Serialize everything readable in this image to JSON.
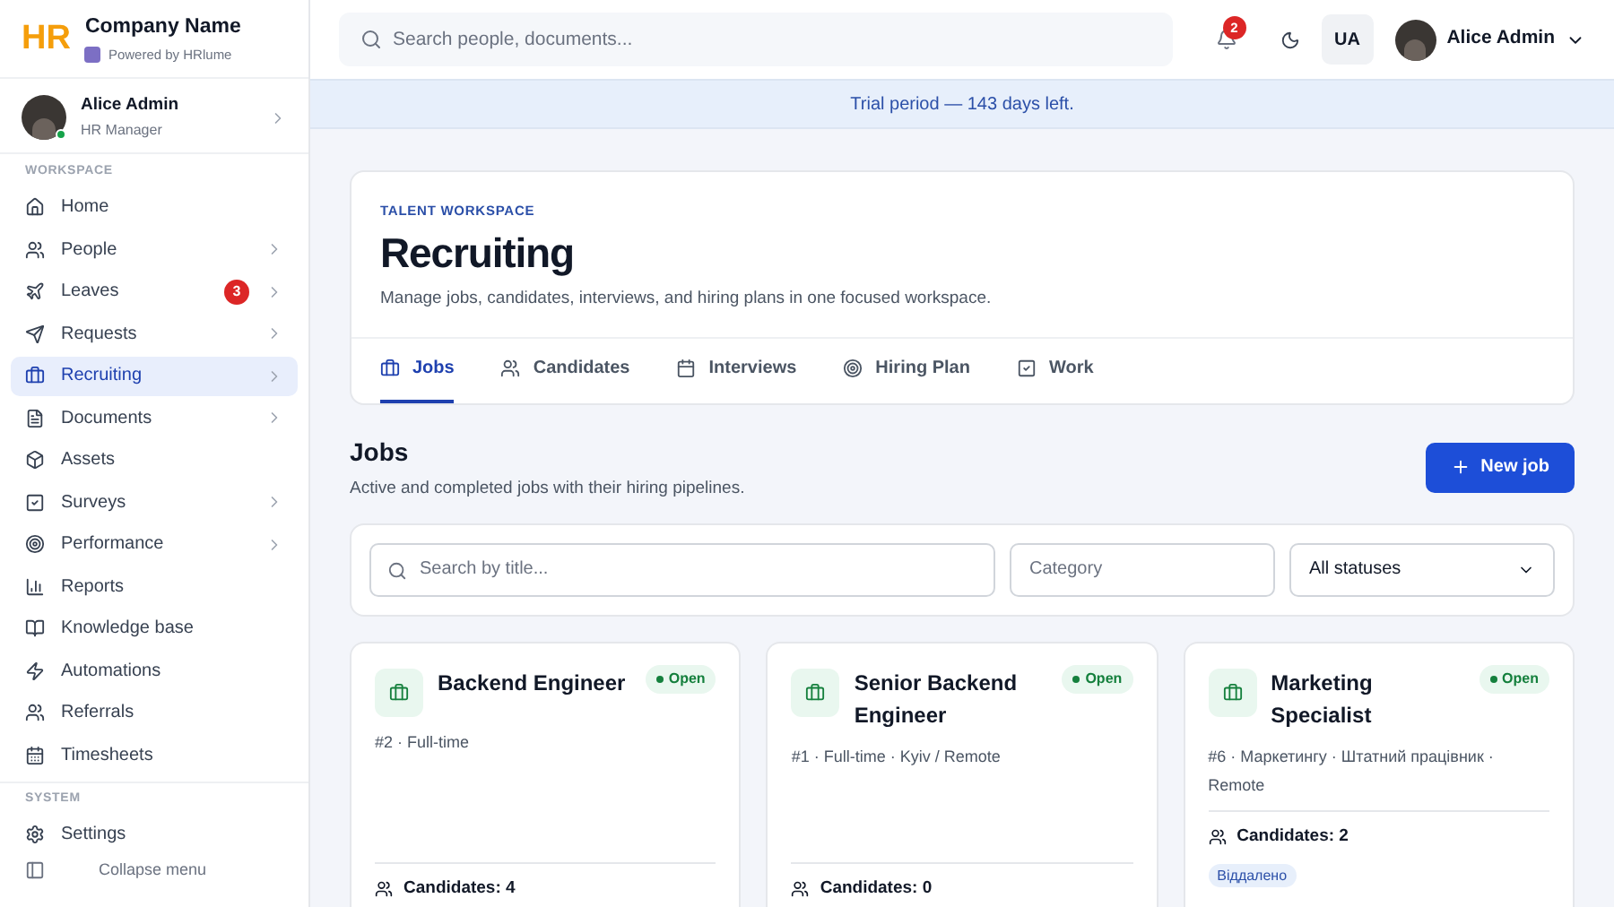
{
  "brand": {
    "logo": "HR",
    "name": "Company Name",
    "powered_by": "Powered by HRlume"
  },
  "user_card": {
    "name": "Alice Admin",
    "role": "HR Manager",
    "online": true
  },
  "sidebar": {
    "sections": [
      {
        "title": "WORKSPACE",
        "items": [
          {
            "label": "Home",
            "selected": false,
            "has_children": false
          },
          {
            "label": "People",
            "selected": false,
            "has_children": true
          },
          {
            "label": "Leaves",
            "selected": false,
            "has_children": true,
            "badge": "3"
          },
          {
            "label": "Requests",
            "selected": false,
            "has_children": true
          },
          {
            "label": "Recruiting",
            "selected": true,
            "has_children": true
          },
          {
            "label": "Documents",
            "selected": false,
            "has_children": true
          },
          {
            "label": "Assets",
            "selected": false,
            "has_children": false
          },
          {
            "label": "Surveys",
            "selected": false,
            "has_children": true
          },
          {
            "label": "Performance",
            "selected": false,
            "has_children": true
          },
          {
            "label": "Reports",
            "selected": false,
            "has_children": false
          },
          {
            "label": "Knowledge base",
            "selected": false,
            "has_children": false
          },
          {
            "label": "Automations",
            "selected": false,
            "has_children": false
          },
          {
            "label": "Referrals",
            "selected": false,
            "has_children": false
          },
          {
            "label": "Timesheets",
            "selected": false,
            "has_children": false
          }
        ]
      },
      {
        "title": "SYSTEM",
        "items": [
          {
            "label": "Settings",
            "selected": false,
            "has_children": false
          }
        ]
      }
    ],
    "collapse": "Collapse menu"
  },
  "topbar": {
    "search_placeholder": "Search people, documents...",
    "notifications": "2",
    "language": "UA",
    "user": "Alice Admin"
  },
  "banner": "Trial period — 143 days left.",
  "header": {
    "eyebrow": "TALENT WORKSPACE",
    "title": "Recruiting",
    "subtitle": "Manage jobs, candidates, interviews, and hiring plans in one focused workspace.",
    "tabs": [
      {
        "label": "Jobs",
        "selected": true
      },
      {
        "label": "Candidates",
        "selected": false
      },
      {
        "label": "Interviews",
        "selected": false
      },
      {
        "label": "Hiring Plan",
        "selected": false
      },
      {
        "label": "Work",
        "selected": false
      }
    ]
  },
  "jobs": {
    "title": "Jobs",
    "subtitle": "Active and completed jobs with their hiring pipelines.",
    "new_button": "New job",
    "filters": {
      "search_placeholder": "Search by title...",
      "category_placeholder": "Category",
      "status": "All statuses"
    },
    "cards": [
      {
        "title": "Backend Engineer",
        "status": "Open",
        "meta": "#2 · Full-time",
        "candidates": "Candidates: 4"
      },
      {
        "title": "Senior Backend Engineer",
        "status": "Open",
        "meta": "#1 · Full-time · Kyiv / Remote",
        "candidates": "Candidates: 0"
      },
      {
        "title": "Marketing Specialist",
        "status": "Open",
        "meta": "#6 · Маркетингу · Штатний працівник · Remote",
        "candidates": "Candidates: 2",
        "tag": "Віддалено"
      }
    ]
  }
}
